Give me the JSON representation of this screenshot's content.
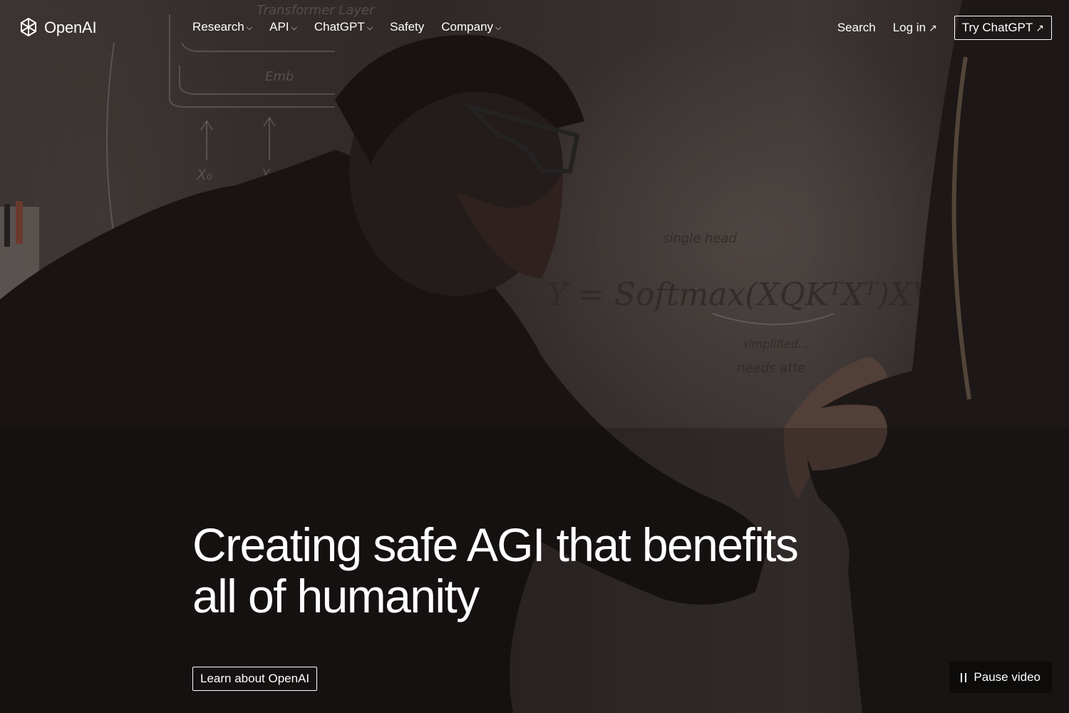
{
  "brand": {
    "name": "OpenAI",
    "logo_icon": "openai-knot-icon"
  },
  "nav": {
    "menu": [
      {
        "label": "Research",
        "has_dropdown": true
      },
      {
        "label": "API",
        "has_dropdown": true
      },
      {
        "label": "ChatGPT",
        "has_dropdown": true
      },
      {
        "label": "Safety",
        "has_dropdown": false
      },
      {
        "label": "Company",
        "has_dropdown": true
      }
    ],
    "search_label": "Search",
    "login_label": "Log in",
    "try_label": "Try ChatGPT",
    "external_arrow": "↗",
    "chevron": "⌵"
  },
  "hero": {
    "headline_line1": "Creating safe AGI that benefits",
    "headline_line2": "all of humanity",
    "cta_label": "Learn about OpenAI",
    "pause_label": "Pause video"
  },
  "background": {
    "whiteboard_text": {
      "top": "Transformer Layer",
      "emb": "Emb",
      "x0": "X₀",
      "x1": "X₁",
      "single_head": "single head",
      "formula": "Y = Softmax(XQKᵀXᵀ)XV",
      "simplified": "simplified...",
      "needs": "needs atte"
    }
  }
}
